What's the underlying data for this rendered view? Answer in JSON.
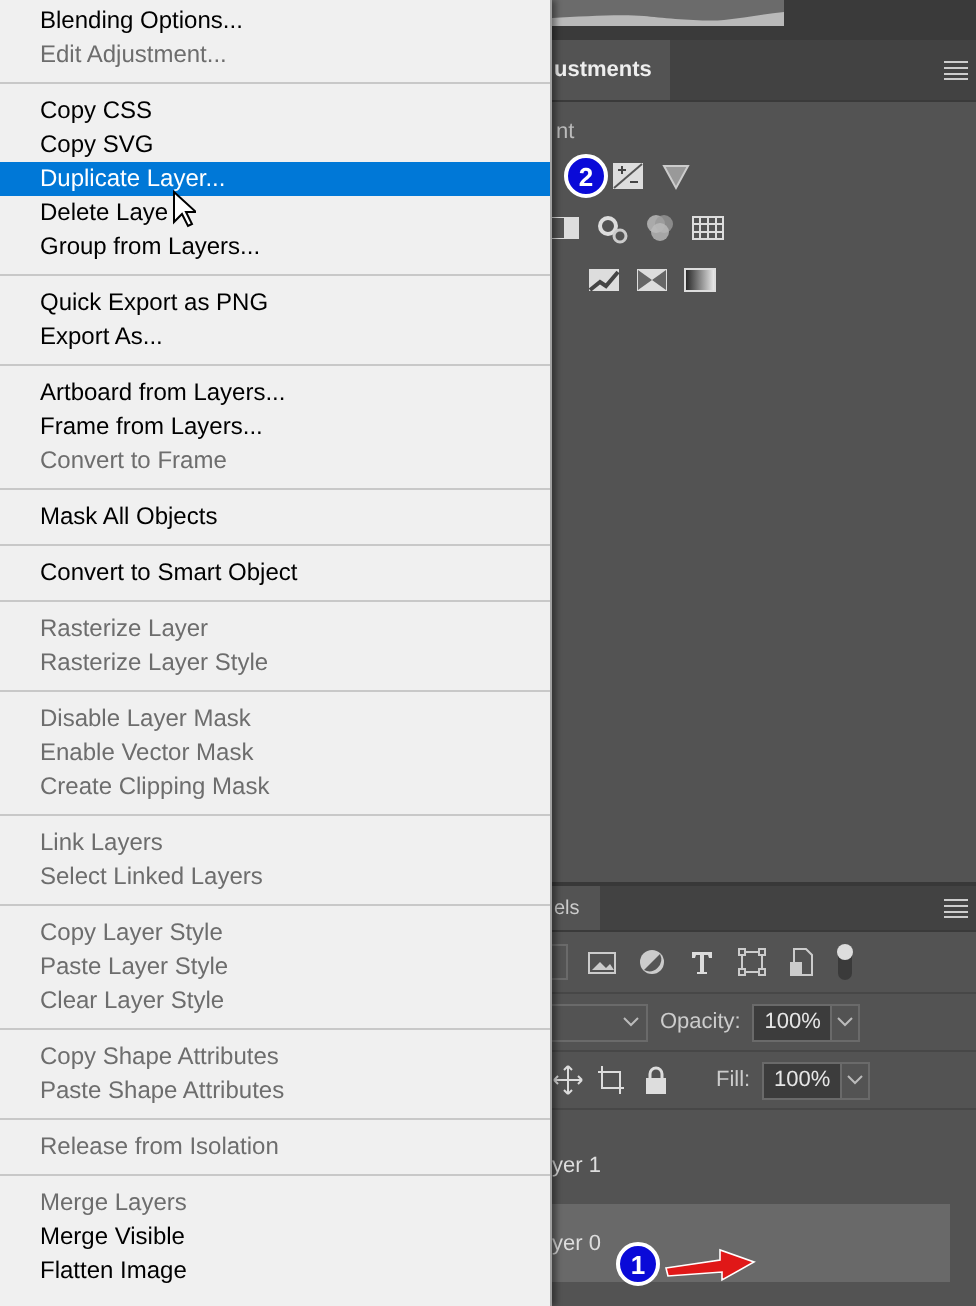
{
  "context_menu": {
    "groups": [
      [
        {
          "label": "Blending Options...",
          "disabled": false,
          "selected": false
        },
        {
          "label": "Edit Adjustment...",
          "disabled": true,
          "selected": false
        }
      ],
      [
        {
          "label": "Copy CSS",
          "disabled": false,
          "selected": false
        },
        {
          "label": "Copy SVG",
          "disabled": false,
          "selected": false
        },
        {
          "label": "Duplicate Layer...",
          "disabled": false,
          "selected": true
        },
        {
          "label": "Delete Laye",
          "disabled": false,
          "selected": false
        },
        {
          "label": "Group from Layers...",
          "disabled": false,
          "selected": false
        }
      ],
      [
        {
          "label": "Quick Export as PNG",
          "disabled": false,
          "selected": false
        },
        {
          "label": "Export As...",
          "disabled": false,
          "selected": false
        }
      ],
      [
        {
          "label": "Artboard from Layers...",
          "disabled": false,
          "selected": false
        },
        {
          "label": "Frame from Layers...",
          "disabled": false,
          "selected": false
        },
        {
          "label": "Convert to Frame",
          "disabled": true,
          "selected": false
        }
      ],
      [
        {
          "label": "Mask All Objects",
          "disabled": false,
          "selected": false
        }
      ],
      [
        {
          "label": "Convert to Smart Object",
          "disabled": false,
          "selected": false
        }
      ],
      [
        {
          "label": "Rasterize Layer",
          "disabled": true,
          "selected": false
        },
        {
          "label": "Rasterize Layer Style",
          "disabled": true,
          "selected": false
        }
      ],
      [
        {
          "label": "Disable Layer Mask",
          "disabled": true,
          "selected": false
        },
        {
          "label": "Enable Vector Mask",
          "disabled": true,
          "selected": false
        },
        {
          "label": "Create Clipping Mask",
          "disabled": true,
          "selected": false
        }
      ],
      [
        {
          "label": "Link Layers",
          "disabled": true,
          "selected": false
        },
        {
          "label": "Select Linked Layers",
          "disabled": true,
          "selected": false
        }
      ],
      [
        {
          "label": "Copy Layer Style",
          "disabled": true,
          "selected": false
        },
        {
          "label": "Paste Layer Style",
          "disabled": true,
          "selected": false
        },
        {
          "label": "Clear Layer Style",
          "disabled": true,
          "selected": false
        }
      ],
      [
        {
          "label": "Copy Shape Attributes",
          "disabled": true,
          "selected": false
        },
        {
          "label": "Paste Shape Attributes",
          "disabled": true,
          "selected": false
        }
      ],
      [
        {
          "label": "Release from Isolation",
          "disabled": true,
          "selected": false
        }
      ],
      [
        {
          "label": "Merge Layers",
          "disabled": true,
          "selected": false
        },
        {
          "label": "Merge Visible",
          "disabled": false,
          "selected": false
        },
        {
          "label": "Flatten Image",
          "disabled": false,
          "selected": false
        }
      ]
    ]
  },
  "adjustments_panel": {
    "tab": "ustments",
    "section_label": "nt",
    "callout": "2"
  },
  "layers_panel": {
    "tab": "els",
    "opacity_label": "Opacity:",
    "opacity_value": "100%",
    "fill_label": "Fill:",
    "fill_value": "100%",
    "layers": [
      {
        "name": "yer 1",
        "selected": false
      },
      {
        "name": "yer 0",
        "selected": true
      }
    ],
    "callout": "1"
  }
}
